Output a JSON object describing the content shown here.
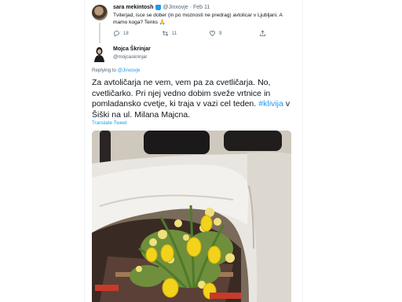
{
  "tweet1": {
    "author_name": "sara mekintosh",
    "handle": "@Jinxovje",
    "separator": "·",
    "date": "Feb 11",
    "text": "Tviterjad, isce se dober (in po moznosti ne predrag) avtolicar v Ljubljani. A mamo koga? Tenks 🙏",
    "actions": {
      "replies": "18",
      "retweets": "11",
      "likes": "9"
    }
  },
  "tweet2": {
    "author_name": "Mojca Škrinjar",
    "handle": "@mojcaskrinjar",
    "replying_prefix": "Replying to",
    "replying_to": "@Jinxovje",
    "text_before_hashtag": "Za avtoličarja ne vem, vem pa za cvetličarja. No, cvetličarko. Pri njej vedno dobim sveže vrtnice in pomladansko cvetje, ki traja v vazi cel teden. ",
    "hashtag": "#klivija",
    "text_after_hashtag": " v Šiški na ul. Milana Majcna.",
    "translate_label": "Translate Tweet"
  },
  "colors": {
    "text": "#0f1419",
    "secondary_text": "#536471",
    "link": "#1d9bf0",
    "tulip_yellow": "#f2d21a"
  },
  "icons": [
    "reply-icon",
    "retweet-icon",
    "like-icon",
    "share-icon",
    "verified-icon"
  ]
}
